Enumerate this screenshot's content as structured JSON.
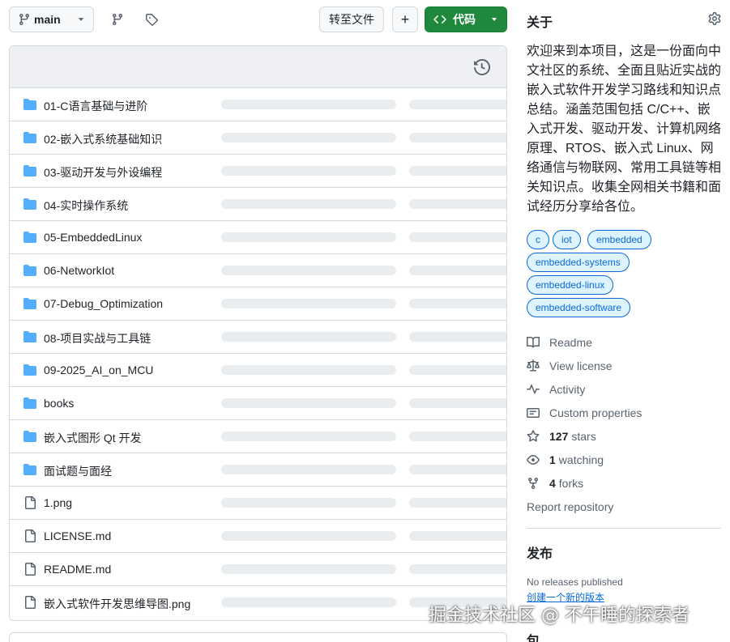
{
  "toolbar": {
    "branch_label": "main",
    "goto_file_label": "转至文件",
    "add_label": "+",
    "code_label": "代码"
  },
  "files": [
    {
      "name": "01-C语言基础与进阶",
      "type": "folder"
    },
    {
      "name": "02-嵌入式系统基础知识",
      "type": "folder"
    },
    {
      "name": "03-驱动开发与外设编程",
      "type": "folder"
    },
    {
      "name": "04-实时操作系统",
      "type": "folder"
    },
    {
      "name": "05-EmbeddedLinux",
      "type": "folder"
    },
    {
      "name": "06-NetworkIot",
      "type": "folder"
    },
    {
      "name": "07-Debug_Optimization",
      "type": "folder"
    },
    {
      "name": "08-项目实战与工具链",
      "type": "folder"
    },
    {
      "name": "09-2025_AI_on_MCU",
      "type": "folder"
    },
    {
      "name": "books",
      "type": "folder"
    },
    {
      "name": "嵌入式图形 Qt 开发",
      "type": "folder"
    },
    {
      "name": "面试题与面经",
      "type": "folder"
    },
    {
      "name": "1.png",
      "type": "file"
    },
    {
      "name": "LICENSE.md",
      "type": "file"
    },
    {
      "name": "README.md",
      "type": "file"
    },
    {
      "name": "嵌入式软件开发思维导图.png",
      "type": "file"
    }
  ],
  "about": {
    "heading": "关于",
    "description": "欢迎来到本项目，这是一份面向中文社区的系统、全面且贴近实战的嵌入式软件开发学习路线和知识点总结。涵盖范围包括 C/C++、嵌入式开发、驱动开发、计算机网络原理、RTOS、嵌入式 Linux、网络通信与物联网、常用工具链等相关知识点。收集全网相关书籍和面试经历分享给各位。",
    "topics": [
      "c",
      "iot",
      "embedded",
      "embedded-systems",
      "embedded-linux",
      "embedded-software"
    ],
    "links": {
      "readme": "Readme",
      "license": "View license",
      "activity": "Activity",
      "custom_props": "Custom properties",
      "stars_count": "127",
      "stars_label": "stars",
      "watching_count": "1",
      "watching_label": "watching",
      "forks_count": "4",
      "forks_label": "forks",
      "report": "Report repository"
    }
  },
  "releases": {
    "heading": "发布",
    "none_text": "No releases published",
    "create_link": "创建一个新的版本"
  },
  "packages": {
    "heading": "包"
  },
  "watermark": "掘金技术社区 @ 不午睡的探索者",
  "icons": {
    "branch": "git-branch-icon",
    "branches": "branches-icon",
    "tags": "tag-icon",
    "history": "history-icon",
    "folder": "folder-icon",
    "file": "file-icon",
    "gear": "gear-icon"
  },
  "colors": {
    "accent": "#0969da",
    "code_button": "#1f883d",
    "folder": "#54aeff",
    "topic_bg": "#ddf4ff"
  }
}
